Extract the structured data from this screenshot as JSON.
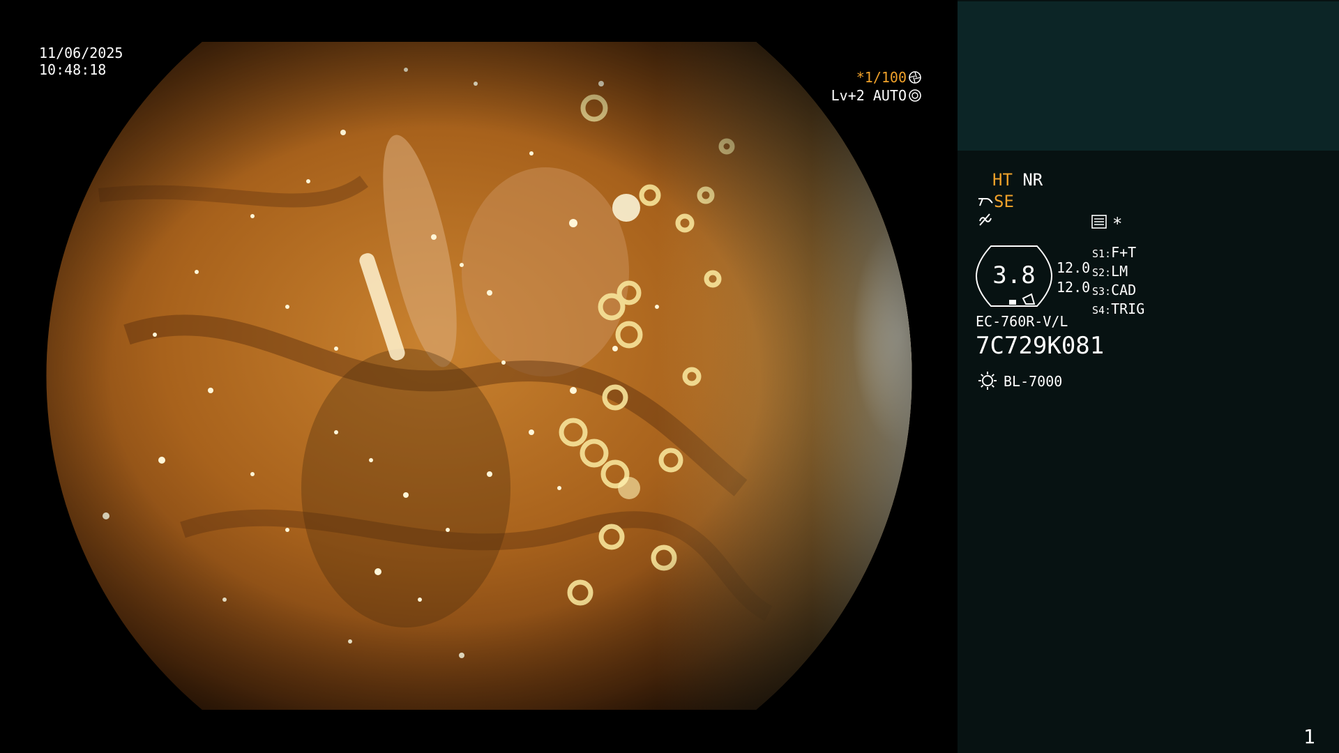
{
  "view": {
    "date": "11/06/2025",
    "time": "10:48:18",
    "shutter": "*1/100",
    "level": "Lv+2 AUTO"
  },
  "panel": {
    "ht": "HT",
    "nr": "NR",
    "se": "SE",
    "zoom": "3.8",
    "ratio_top": "12.0",
    "ratio_bottom": "12.0",
    "switches": [
      {
        "key": "S1:",
        "value": "F+T"
      },
      {
        "key": "S2:",
        "value": "LM"
      },
      {
        "key": "S3:",
        "value": "CAD"
      },
      {
        "key": "S4:",
        "value": "TRIG"
      }
    ],
    "star": "*",
    "scope_model": "EC-760R-V/L",
    "scope_serial": "7C729K081",
    "light_source": "BL-7000",
    "page": "1"
  },
  "colors": {
    "accent_orange": "#f0a12a",
    "panel_bg": "#071212",
    "panel_top_bg": "#0c2526",
    "text": "#ffffff"
  },
  "icons": [
    "aperture-icon",
    "iris-icon",
    "enhance-icon",
    "contrast-icon",
    "menu-icon",
    "light-source-icon"
  ]
}
